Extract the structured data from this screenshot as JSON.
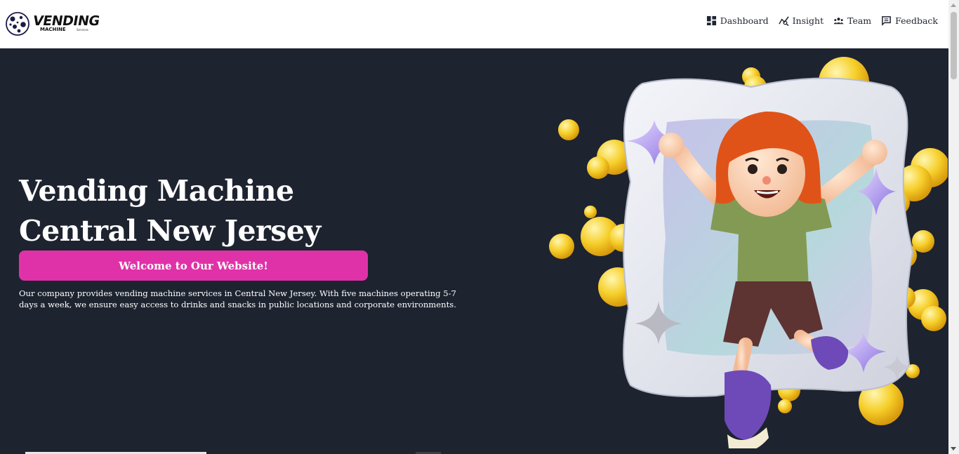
{
  "logo": {
    "wordmark": "VENDING",
    "subtitle": "MACHINE",
    "tagline": "Services"
  },
  "nav": {
    "items": [
      {
        "label": "Dashboard",
        "icon": "dashboard-icon"
      },
      {
        "label": "Insight",
        "icon": "insight-icon"
      },
      {
        "label": "Team",
        "icon": "team-icon"
      },
      {
        "label": "Feedback",
        "icon": "feedback-icon"
      }
    ]
  },
  "hero": {
    "title_line1": "Vending Machine",
    "title_line2": "Central New Jersey",
    "button_label": "Welcome to Our Website!",
    "description": "Our company provides vending machine services in Central New Jersey. With five machines operating 5-7 days a week, we ensure easy access to drinks and snacks in public locations and corporate environments."
  },
  "colors": {
    "hero_background": "#1e2330",
    "button": "#e032a8",
    "header": "#ffffff"
  }
}
